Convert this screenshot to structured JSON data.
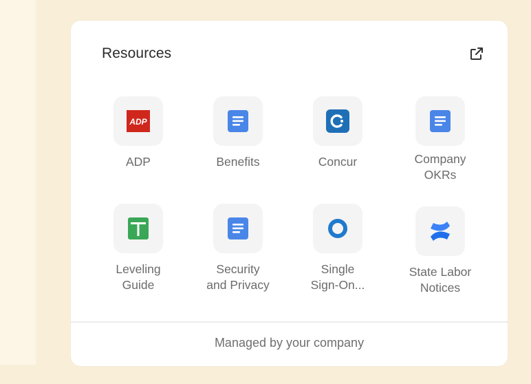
{
  "card": {
    "title": "Resources",
    "footer": "Managed by your company"
  },
  "icons": {
    "external_link": "external-link-icon"
  },
  "resources": [
    {
      "label": "ADP",
      "icon": "adp-logo-icon",
      "color": "#d0271d"
    },
    {
      "label": "Benefits",
      "icon": "document-icon",
      "color": "#4a86e8"
    },
    {
      "label": "Concur",
      "icon": "concur-logo-icon",
      "color": "#1f6fb7"
    },
    {
      "label": "Company\nOKRs",
      "icon": "document-icon",
      "color": "#4a86e8"
    },
    {
      "label": "Leveling\nGuide",
      "icon": "spreadsheet-icon",
      "color": "#3aa757"
    },
    {
      "label": "Security\nand Privacy",
      "icon": "document-icon",
      "color": "#4a86e8"
    },
    {
      "label": "Single\nSign-On...",
      "icon": "sso-ring-icon",
      "color": "#1f7acc"
    },
    {
      "label": "State Labor\nNotices",
      "icon": "confluence-logo-icon",
      "color": "#1f6feb"
    }
  ]
}
